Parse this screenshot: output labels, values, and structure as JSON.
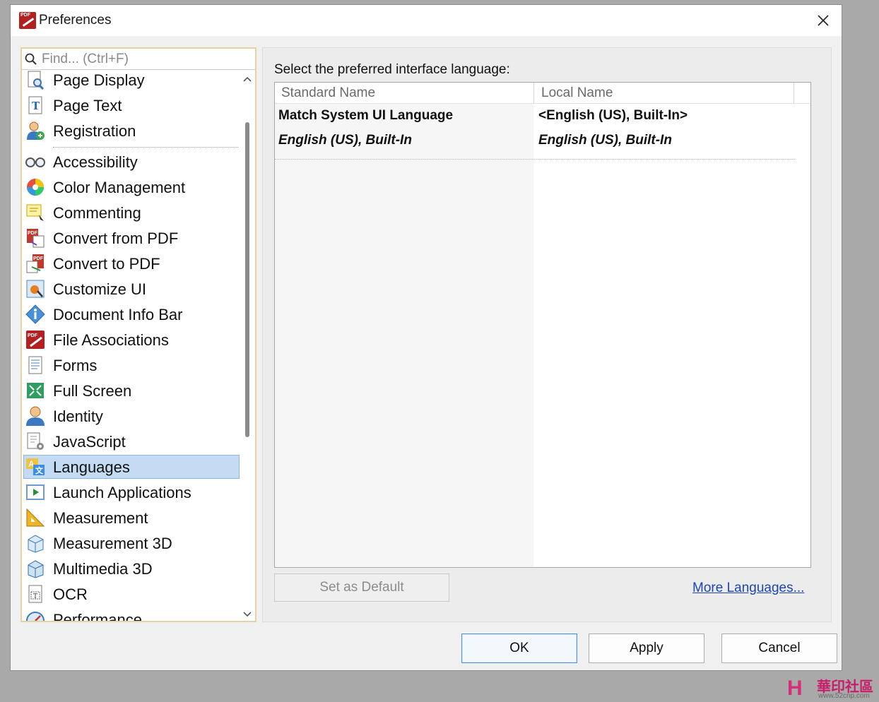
{
  "window": {
    "title": "Preferences"
  },
  "search": {
    "placeholder": "Find... (Ctrl+F)",
    "value": ""
  },
  "categories": {
    "top_group": [
      {
        "label": "Page Display",
        "icon": "page-display-icon"
      },
      {
        "label": "Page Text",
        "icon": "page-text-icon"
      },
      {
        "label": "Registration",
        "icon": "registration-icon"
      }
    ],
    "items": [
      {
        "label": "Accessibility",
        "icon": "accessibility-icon"
      },
      {
        "label": "Color Management",
        "icon": "color-management-icon"
      },
      {
        "label": "Commenting",
        "icon": "commenting-icon"
      },
      {
        "label": "Convert from PDF",
        "icon": "convert-from-pdf-icon"
      },
      {
        "label": "Convert to PDF",
        "icon": "convert-to-pdf-icon"
      },
      {
        "label": "Customize UI",
        "icon": "customize-ui-icon"
      },
      {
        "label": "Document Info Bar",
        "icon": "document-info-bar-icon"
      },
      {
        "label": "File Associations",
        "icon": "file-associations-icon"
      },
      {
        "label": "Forms",
        "icon": "forms-icon"
      },
      {
        "label": "Full Screen",
        "icon": "full-screen-icon"
      },
      {
        "label": "Identity",
        "icon": "identity-icon"
      },
      {
        "label": "JavaScript",
        "icon": "javascript-icon"
      },
      {
        "label": "Languages",
        "icon": "languages-icon",
        "selected": true
      },
      {
        "label": "Launch Applications",
        "icon": "launch-applications-icon"
      },
      {
        "label": "Measurement",
        "icon": "measurement-icon"
      },
      {
        "label": "Measurement 3D",
        "icon": "measurement-3d-icon"
      },
      {
        "label": "Multimedia 3D",
        "icon": "multimedia-3d-icon"
      },
      {
        "label": "OCR",
        "icon": "ocr-icon"
      },
      {
        "label": "Performance",
        "icon": "performance-icon"
      }
    ]
  },
  "languages": {
    "instruction": "Select the preferred interface language:",
    "columns": [
      "Standard Name",
      "Local Name"
    ],
    "rows": [
      {
        "standard": "Match System UI Language",
        "local": "<English (US), Built-In>",
        "style": "bold"
      },
      {
        "standard": "English (US), Built-In",
        "local": "English (US), Built-In",
        "style": "bolditalic"
      }
    ],
    "set_default_label": "Set as Default",
    "more_languages_label": "More Languages..."
  },
  "footer": {
    "ok_label": "OK",
    "apply_label": "Apply",
    "cancel_label": "Cancel"
  },
  "watermark": {
    "brand": "華印社區",
    "url": "www.52cnp.com"
  },
  "colors": {
    "selection": "#c4dcf3",
    "link": "#1f45b5",
    "ok_border": "#4f93d8",
    "search_border": "#e6d3a3"
  }
}
